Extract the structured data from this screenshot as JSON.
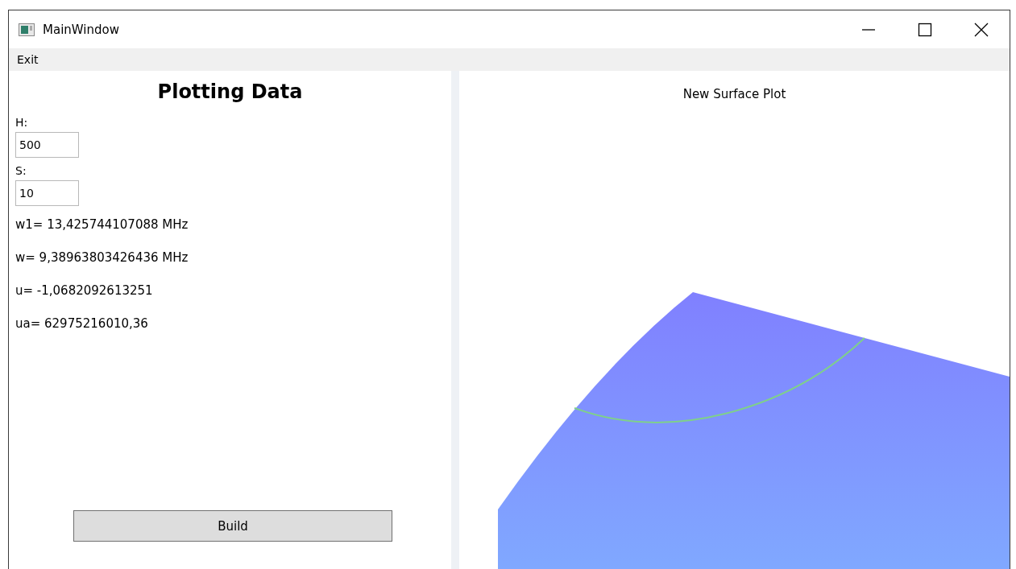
{
  "window": {
    "title": "MainWindow"
  },
  "menu": [
    "Exit"
  ],
  "left_panel": {
    "heading": "Plotting Data",
    "fields": [
      {
        "label": "H:",
        "value": "500"
      },
      {
        "label": "S:",
        "value": "10"
      }
    ],
    "results": [
      "w1= 13,425744107088 MHz",
      "w= 9,38963803426436 MHz",
      "u= -1,0682092613251",
      "ua= 62975216010,36"
    ],
    "button": "Build"
  },
  "plot": {
    "title": "New Surface Plot",
    "kind": "picture"
  }
}
